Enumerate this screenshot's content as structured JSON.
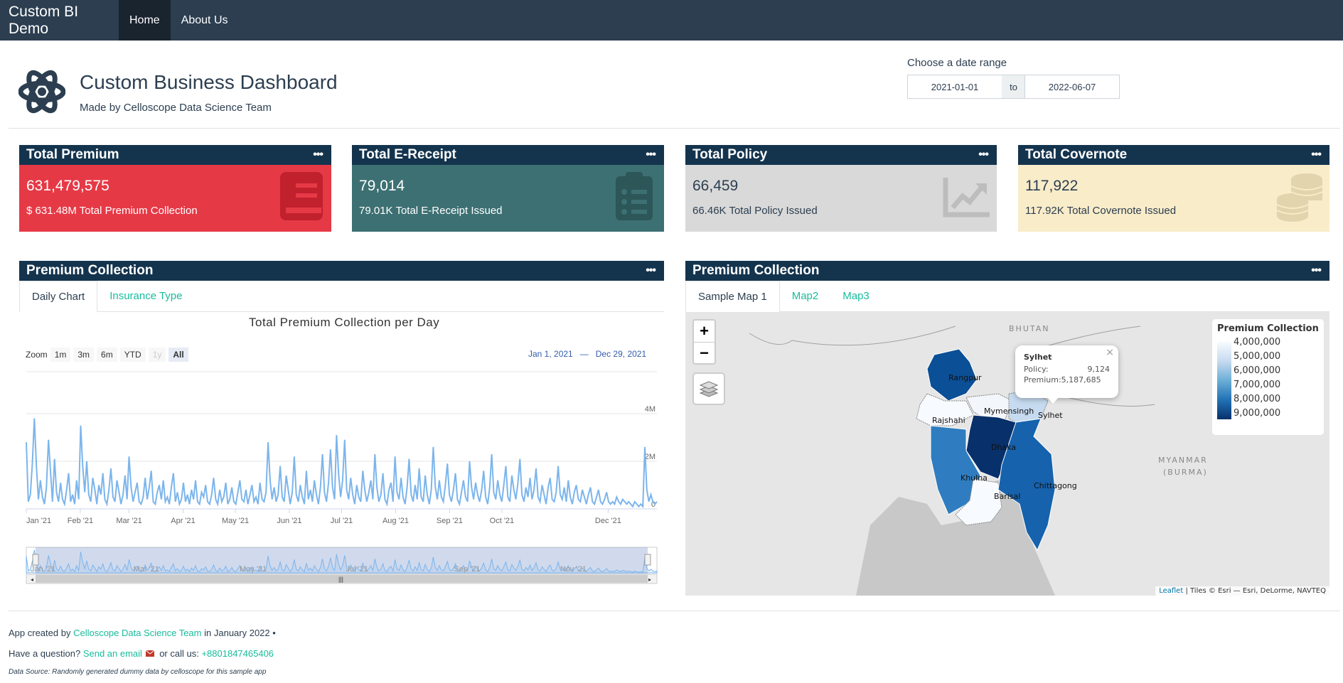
{
  "navbar": {
    "brand": "Custom BI Demo",
    "items": [
      {
        "label": "Home"
      },
      {
        "label": "About Us"
      }
    ]
  },
  "header": {
    "title": "Custom Business Dashboard",
    "subtitle": "Made by Celloscope Data Science Team",
    "date_range": {
      "label": "Choose a date range",
      "start": "2021-01-01",
      "separator": "to",
      "end": "2022-06-07"
    }
  },
  "value_boxes": [
    {
      "title": "Total Premium",
      "value": "631,479,575",
      "subtitle": "$ 631.48M Total Premium Collection",
      "icon": "book-icon",
      "color": "#e63946"
    },
    {
      "title": "Total E-Receipt",
      "value": "79,014",
      "subtitle": "79.01K Total E-Receipt Issued",
      "icon": "clipboard-list-icon",
      "color": "#3d7073"
    },
    {
      "title": "Total Policy",
      "value": "66,459",
      "subtitle": "66.46K Total Policy Issued",
      "icon": "chart-line-icon",
      "color": "#d9d9d9"
    },
    {
      "title": "Total Covernote",
      "value": "117,922",
      "subtitle": "117.92K Total Covernote Issued",
      "icon": "coins-icon",
      "color": "#f8ecc9"
    }
  ],
  "left_panel": {
    "title": "Premium Collection",
    "tabs": [
      {
        "label": "Daily Chart"
      },
      {
        "label": "Insurance Type"
      }
    ],
    "zoom_label": "Zoom",
    "zoom_buttons": [
      "1m",
      "3m",
      "6m",
      "YTD",
      "1y",
      "All"
    ],
    "range_from": "Jan 1, 2021",
    "range_dash": "—",
    "range_to": "Dec 29, 2021",
    "navigator_labels": [
      "Jan '21",
      "Mar '21",
      "May '21",
      "Jul '21",
      "Sep '21",
      "Nov '21"
    ]
  },
  "chart_data": {
    "type": "line",
    "title": "Total Premium Collection per Day",
    "xlabel": "",
    "ylabel": "",
    "x_range": [
      "2021-01-01",
      "2021-12-29"
    ],
    "ylim": [
      0,
      4000000
    ],
    "y_ticks": [
      "4M",
      "2M",
      "0"
    ],
    "x_ticks": [
      "Jan '21",
      "Feb '21",
      "Mar '21",
      "Apr '21",
      "May '21",
      "Jun '21",
      "Jul '21",
      "Aug '21",
      "Sep '21",
      "Oct '21",
      "Dec '21"
    ],
    "grid": true,
    "series": [
      {
        "values": [
          2800000,
          300000,
          600000,
          1900000,
          3800000,
          1800000,
          400000,
          1200000,
          500000,
          200000,
          900000,
          2900000,
          1600000,
          300000,
          2100000,
          700000,
          300000,
          1100000,
          400000,
          200000,
          800000,
          1500000,
          300000,
          600000,
          200000,
          1200000,
          400000,
          3500000,
          1800000,
          700000,
          2000000,
          600000,
          300000,
          1300000,
          800000,
          200000,
          1000000,
          600000,
          1500000,
          400000,
          200000,
          800000,
          1700000,
          500000,
          300000,
          1200000,
          700000,
          200000,
          600000,
          1400000,
          400000,
          2200000,
          900000,
          300000,
          700000,
          1100000,
          300000,
          200000,
          500000,
          1300000,
          400000,
          900000,
          1600000,
          300000,
          200000,
          700000,
          1000000,
          400000,
          1200000,
          300000,
          500000,
          200000,
          900000,
          1500000,
          300000,
          700000,
          200000,
          400000,
          1100000,
          300000,
          600000,
          200000,
          800000,
          400000,
          1200000,
          300000,
          200000,
          700000,
          500000,
          1000000,
          300000,
          200000,
          600000,
          1300000,
          400000,
          200000,
          800000,
          300000,
          500000,
          1100000,
          200000,
          400000,
          900000,
          300000,
          200000,
          700000,
          1200000,
          400000,
          300000,
          800000,
          200000,
          600000,
          1000000,
          300000,
          500000,
          200000,
          1100000,
          400000,
          300000,
          700000,
          2800000,
          1200000,
          400000,
          900000,
          300000,
          600000,
          1800000,
          500000,
          300000,
          1400000,
          800000,
          200000,
          700000,
          2200000,
          600000,
          300000,
          1000000,
          500000,
          200000,
          1600000,
          400000,
          800000,
          300000,
          1200000,
          600000,
          200000,
          900000,
          2300000,
          700000,
          300000,
          1100000,
          2500000,
          900000,
          400000,
          3100000,
          1500000,
          500000,
          1200000,
          2900000,
          800000,
          400000,
          1300000,
          600000,
          200000,
          1000000,
          500000,
          300000,
          1600000,
          800000,
          300000,
          700000,
          1200000,
          400000,
          2300000,
          900000,
          300000,
          600000,
          1500000,
          400000,
          200000,
          800000,
          1100000,
          300000,
          2200000,
          700000,
          400000,
          1300000,
          500000,
          200000,
          900000,
          2100000,
          600000,
          300000,
          1000000,
          400000,
          1700000,
          500000,
          300000,
          1400000,
          600000,
          200000,
          800000,
          2600000,
          900000,
          400000,
          1200000,
          500000,
          300000,
          1000000,
          1900000,
          600000,
          300000,
          800000,
          1500000,
          400000,
          200000,
          700000,
          1200000,
          500000,
          300000,
          2000000,
          900000,
          400000,
          1100000,
          600000,
          300000,
          800000,
          1600000,
          500000,
          200000,
          900000,
          2300000,
          700000,
          400000,
          1200000,
          600000,
          300000,
          1000000,
          1800000,
          500000,
          300000,
          1400000,
          800000,
          400000,
          1100000,
          2100000,
          600000,
          300000,
          900000,
          500000,
          1300000,
          400000,
          800000,
          1700000,
          500000,
          300000,
          1000000,
          600000,
          200000,
          900000,
          1300000,
          400000,
          300000,
          700000,
          1800000,
          600000,
          400000,
          900000,
          300000,
          1200000,
          500000,
          200000,
          700000,
          1000000,
          400000,
          300000,
          800000,
          500000,
          200000,
          600000,
          900000,
          300000,
          200000,
          500000,
          800000,
          300000,
          200000,
          400000,
          700000,
          300000,
          200000,
          300000,
          200000,
          500000,
          300000,
          200000,
          400000,
          300000,
          200000,
          300000,
          200000,
          100000,
          300000,
          200000,
          100000,
          200000,
          100000,
          2600000,
          800000,
          300000,
          600000,
          300000,
          200000,
          300000
        ]
      }
    ]
  },
  "right_panel": {
    "title": "Premium Collection",
    "tabs": [
      {
        "label": "Sample Map 1"
      },
      {
        "label": "Map2"
      },
      {
        "label": "Map3"
      }
    ],
    "zoom_in": "+",
    "zoom_out": "−",
    "legend": {
      "title": "Premium Collection",
      "labels": [
        "4,000,000",
        "5,000,000",
        "6,000,000",
        "7,000,000",
        "8,000,000",
        "9,000,000"
      ]
    },
    "popup": {
      "name": "Sylhet",
      "policy_label": "Policy:",
      "policy_value": "9,124",
      "premium_label": "Premium:",
      "premium_value": "5,187,685",
      "close": "×"
    },
    "regions": [
      {
        "name": "Rangpur",
        "color": "#0b4f96"
      },
      {
        "name": "Rajshahi",
        "color": "#f7fbff"
      },
      {
        "name": "Mymensingh",
        "color": "#f3f7fc"
      },
      {
        "name": "Sylhet",
        "color": "#c6dbef"
      },
      {
        "name": "Dhaka",
        "color": "#08306b"
      },
      {
        "name": "Khulna",
        "color": "#2f7dc0"
      },
      {
        "name": "Barisal",
        "color": "#f7fbff"
      },
      {
        "name": "Chittagong",
        "color": "#1662ad"
      }
    ],
    "country_labels": [
      "BHUTAN",
      "MYANMAR",
      "(BURMA)"
    ],
    "attribution_link": "Leaflet",
    "attribution_text": "| Tiles © Esri — Esri, DeLorme, NAVTEQ"
  },
  "footer": {
    "created_prefix": "App created by",
    "created_link": "Celloscope Data Science Team",
    "created_suffix": "in January 2022 •",
    "question_prefix": "Have a question?",
    "email_link": "Send an email",
    "call_prefix": "or call us:",
    "phone": "+8801847465406",
    "data_source": "Data Source: Randomly generated dummy data by celloscope for this sample app"
  }
}
